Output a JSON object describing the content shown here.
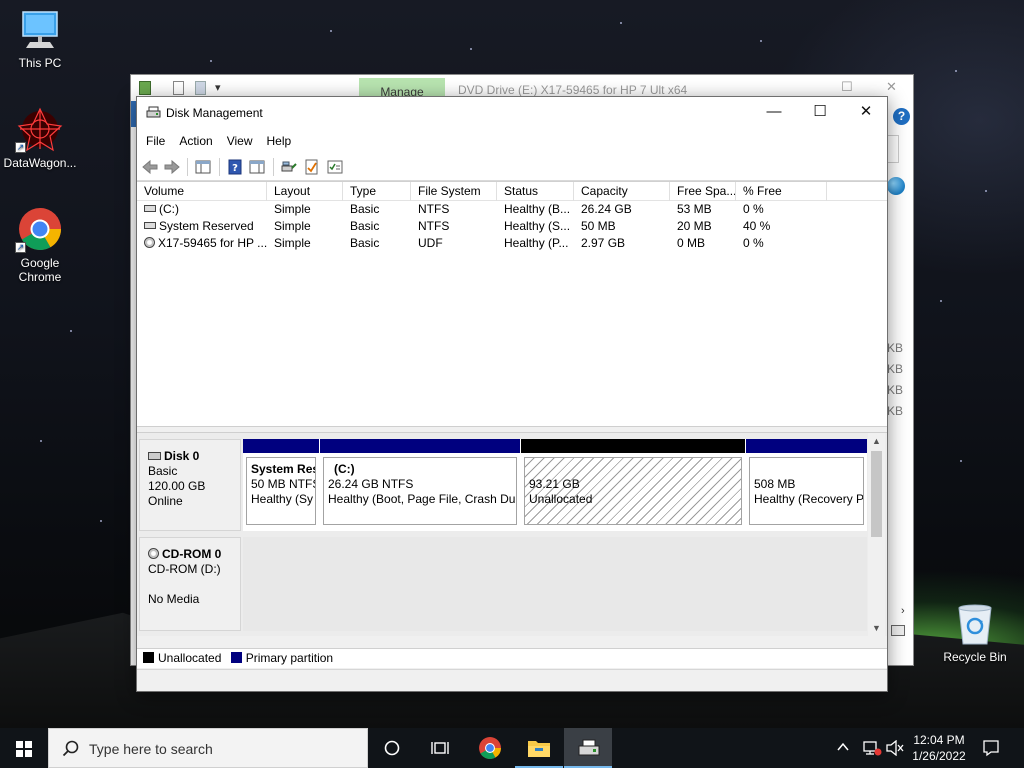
{
  "desktop": {
    "icons": [
      {
        "label": "This PC"
      },
      {
        "label": "DataWagon..."
      },
      {
        "label": "Google Chrome"
      },
      {
        "label": "Recycle Bin"
      }
    ]
  },
  "background_window": {
    "manage_tab": "Manage",
    "title": "DVD Drive (E:) X17-59465 for HP 7 Ult x64",
    "kb_labels": [
      "KB",
      "KB",
      "KB",
      "KB"
    ]
  },
  "disk_management": {
    "title": "Disk Management",
    "menu": [
      "File",
      "Action",
      "View",
      "Help"
    ],
    "columns": [
      "Volume",
      "Layout",
      "Type",
      "File System",
      "Status",
      "Capacity",
      "Free Spa...",
      "% Free"
    ],
    "volumes": [
      {
        "volume": "(C:)",
        "layout": "Simple",
        "type": "Basic",
        "fs": "NTFS",
        "status": "Healthy (B...",
        "capacity": "26.24 GB",
        "free": "53 MB",
        "pct": "0 %"
      },
      {
        "volume": "System Reserved",
        "layout": "Simple",
        "type": "Basic",
        "fs": "NTFS",
        "status": "Healthy (S...",
        "capacity": "50 MB",
        "free": "20 MB",
        "pct": "40 %"
      },
      {
        "volume": "X17-59465 for HP ...",
        "layout": "Simple",
        "type": "Basic",
        "fs": "UDF",
        "status": "Healthy (P...",
        "capacity": "2.97 GB",
        "free": "0 MB",
        "pct": "0 %"
      }
    ],
    "disks": {
      "disk0": {
        "name": "Disk 0",
        "kind": "Basic",
        "size": "120.00 GB",
        "state": "Online",
        "partitions": [
          {
            "name": "System Res",
            "line1": "50 MB NTFS",
            "line2": "Healthy (Sy"
          },
          {
            "name": "(C:)",
            "line1": "26.24 GB NTFS",
            "line2": "Healthy (Boot, Page File, Crash Dur"
          },
          {
            "name": "",
            "line1": "93.21 GB",
            "line2": "Unallocated"
          },
          {
            "name": "",
            "line1": "508 MB",
            "line2": "Healthy (Recovery P"
          }
        ]
      },
      "cdrom0": {
        "name": "CD-ROM 0",
        "kind": "CD-ROM (D:)",
        "media": "No Media"
      }
    },
    "legend": {
      "unallocated": "Unallocated",
      "primary": "Primary partition",
      "unallocated_color": "#000000",
      "primary_color": "#00007f"
    }
  },
  "taskbar": {
    "search_placeholder": "Type here to search",
    "time": "12:04 PM",
    "date": "1/26/2022"
  }
}
